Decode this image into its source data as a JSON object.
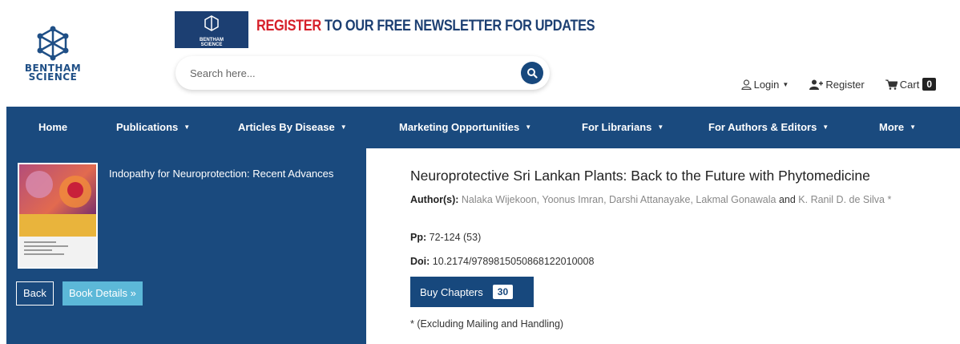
{
  "logo": {
    "line1": "BENTHAM",
    "line2": "SCIENCE"
  },
  "banner": {
    "logo_line1": "BENTHAM",
    "logo_line2": "SCIENCE",
    "text_red": "REGISTER",
    "text_rest": " TO OUR FREE NEWSLETTER FOR UPDATES"
  },
  "search": {
    "placeholder": "Search here..."
  },
  "user_links": {
    "login": "Login",
    "register": "Register",
    "cart": "Cart",
    "cart_count": "0"
  },
  "nav": {
    "items": [
      {
        "label": "Home",
        "dropdown": false
      },
      {
        "label": "Publications",
        "dropdown": true
      },
      {
        "label": "Articles By Disease",
        "dropdown": true
      },
      {
        "label": "Marketing Opportunities",
        "dropdown": true
      },
      {
        "label": "For Librarians",
        "dropdown": true
      },
      {
        "label": "For Authors & Editors",
        "dropdown": true
      },
      {
        "label": "More",
        "dropdown": true
      }
    ]
  },
  "book": {
    "title": "Indopathy for Neuroprotection: Recent Advances",
    "back_label": "Back",
    "details_label": "Book Details »"
  },
  "chapter": {
    "title": "Neuroprotective Sri Lankan Plants: Back to the Future with Phytomedicine",
    "authors_label": "Author(s):",
    "authors_main": "Nalaka Wijekoon, Yoonus Imran, Darshi Attanayake, Lakmal Gonawala",
    "authors_and": "and",
    "authors_last": "K. Ranil D. de Silva *",
    "pp_label": "Pp:",
    "pp_value": "72-124 (53)",
    "doi_label": "Doi:",
    "doi_value": "10.2174/9789815050868122010008",
    "buy_label": "Buy Chapters",
    "buy_count": "30",
    "note": "* (Excluding Mailing and Handling)"
  },
  "colors": {
    "navy": "#1a4a7e",
    "button_blue": "#17487d",
    "light_blue": "#5cb8d8",
    "banner_red": "#d6202a"
  }
}
